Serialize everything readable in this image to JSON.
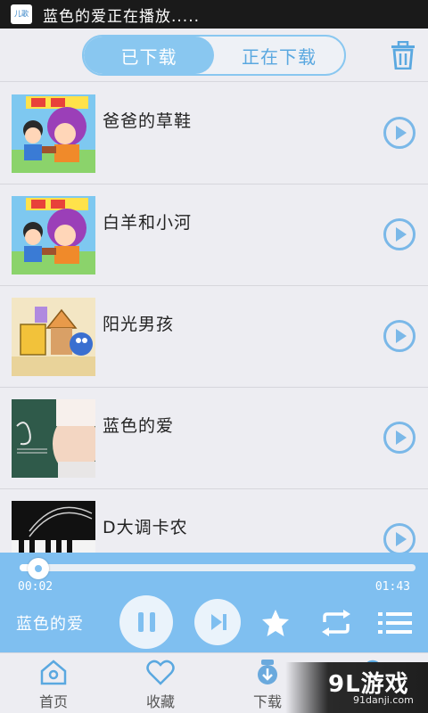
{
  "status_bar": {
    "app_icon_text": "儿歌",
    "text": "蓝色的爱正在播放....."
  },
  "header": {
    "tabs": [
      {
        "label": "已下载",
        "active": true
      },
      {
        "label": "正在下载",
        "active": false
      }
    ],
    "delete_icon": "trash-icon"
  },
  "songs": [
    {
      "title": "爸爸的草鞋",
      "thumb": "cartoon-kids-cover"
    },
    {
      "title": "白羊和小河",
      "thumb": "cartoon-kids-cover"
    },
    {
      "title": "阳光男孩",
      "thumb": "cartoon-blocks-cover"
    },
    {
      "title": "蓝色的爱",
      "thumb": "pregnancy-cover"
    },
    {
      "title": "D大调卡农",
      "thumb": "piano-cover"
    }
  ],
  "player": {
    "elapsed": "00:02",
    "total": "01:43",
    "progress": 0.03,
    "now_playing": "蓝色的爱",
    "controls": [
      "pause-icon",
      "next-icon",
      "star-icon",
      "repeat-icon",
      "playlist-icon"
    ]
  },
  "bottom_nav": {
    "items": [
      {
        "label": "首页",
        "icon": "home-icon"
      },
      {
        "label": "收藏",
        "icon": "heart-icon"
      },
      {
        "label": "下载",
        "icon": "download-icon"
      },
      {
        "label": "",
        "icon": "search-icon"
      }
    ]
  },
  "watermark": {
    "title": "9L游戏",
    "url": "91danji.com"
  },
  "colors": {
    "accent": "#7fbff0",
    "accent_dark": "#5aa8e0",
    "background": "#ededf2"
  }
}
